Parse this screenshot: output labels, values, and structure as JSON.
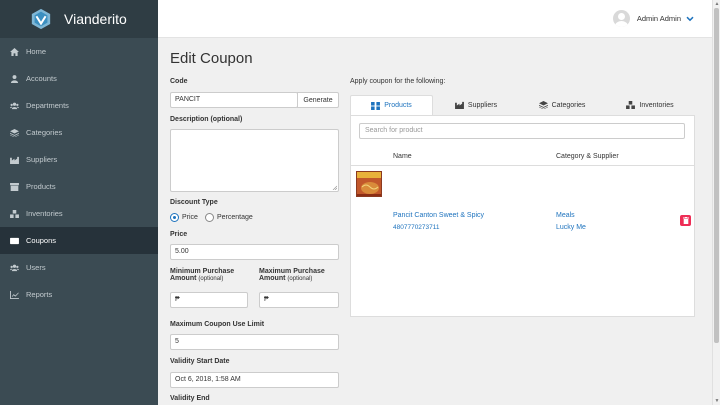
{
  "brand": {
    "name": "Vianderito"
  },
  "sidebar": {
    "items": [
      {
        "label": "Home",
        "icon": "home-icon"
      },
      {
        "label": "Accounts",
        "icon": "user-icon"
      },
      {
        "label": "Departments",
        "icon": "users-icon"
      },
      {
        "label": "Categories",
        "icon": "layers-icon"
      },
      {
        "label": "Suppliers",
        "icon": "industry-icon"
      },
      {
        "label": "Products",
        "icon": "archive-icon"
      },
      {
        "label": "Inventories",
        "icon": "boxes-icon"
      },
      {
        "label": "Coupons",
        "icon": "ticket-icon",
        "active": true
      },
      {
        "label": "Users",
        "icon": "users-icon"
      },
      {
        "label": "Reports",
        "icon": "chart-icon"
      }
    ]
  },
  "topbar": {
    "user_name": "Admin Admin"
  },
  "form": {
    "title": "Edit Coupon",
    "code_label": "Code",
    "code_value": "PANCIT",
    "generate_label": "Generate",
    "description_label": "Description (optional)",
    "description_value": "",
    "discount_type_label": "Discount Type",
    "discount_options": [
      "Price",
      "Percentage"
    ],
    "discount_selected": "Price",
    "price_label": "Price",
    "price_value": "5.00",
    "min_purchase_label": "Minimum Purchase",
    "min_purchase_label2": "Amount",
    "max_purchase_label": "Maximum Purchase",
    "max_purchase_label2": "Amount",
    "optional": "(optional)",
    "currency": "₱",
    "max_use_label": "Maximum Coupon Use Limit",
    "max_use_value": "5",
    "validity_start_label": "Validity Start Date",
    "validity_start_value": "Oct 6, 2018, 1:58 AM",
    "validity_end_label": "Validity End"
  },
  "apply": {
    "label": "Apply coupon for the following:",
    "tabs": [
      {
        "label": "Products",
        "icon": "products-icon",
        "active": true
      },
      {
        "label": "Suppliers",
        "icon": "industry-icon"
      },
      {
        "label": "Categories",
        "icon": "layers-icon"
      },
      {
        "label": "Inventories",
        "icon": "boxes-icon"
      }
    ],
    "search_placeholder": "Search for product",
    "columns": [
      "Name",
      "Category & Supplier"
    ],
    "rows": [
      {
        "name": "Pancit Canton Sweet & Spicy",
        "code": "4807770273711",
        "category": "Meals",
        "supplier": "Lucky Me"
      }
    ]
  },
  "colors": {
    "accent": "#1e73be",
    "danger": "#ee2d56",
    "sidebar": "#3b4b53"
  }
}
